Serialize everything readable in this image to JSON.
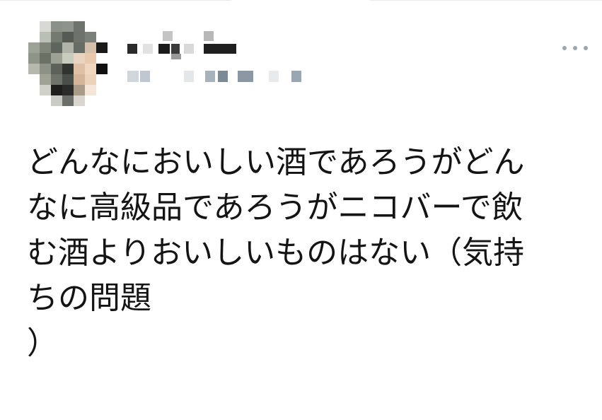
{
  "tweet": {
    "author_avatar": "pixelated-avatar",
    "author_name": "",
    "author_handle": "",
    "menu_icon": "more-horizontal-icon",
    "text_lines": [
      "どんなにおいしい酒であろうがどん",
      "なに高級品であろうがニコバーで飲",
      "む酒よりおいしいものはない（気持",
      "ちの問題",
      "）"
    ]
  },
  "colors": {
    "text": "#141414",
    "icon": "#9aa7b2",
    "divider": "#e6e9ec",
    "background": "#ffffff"
  }
}
